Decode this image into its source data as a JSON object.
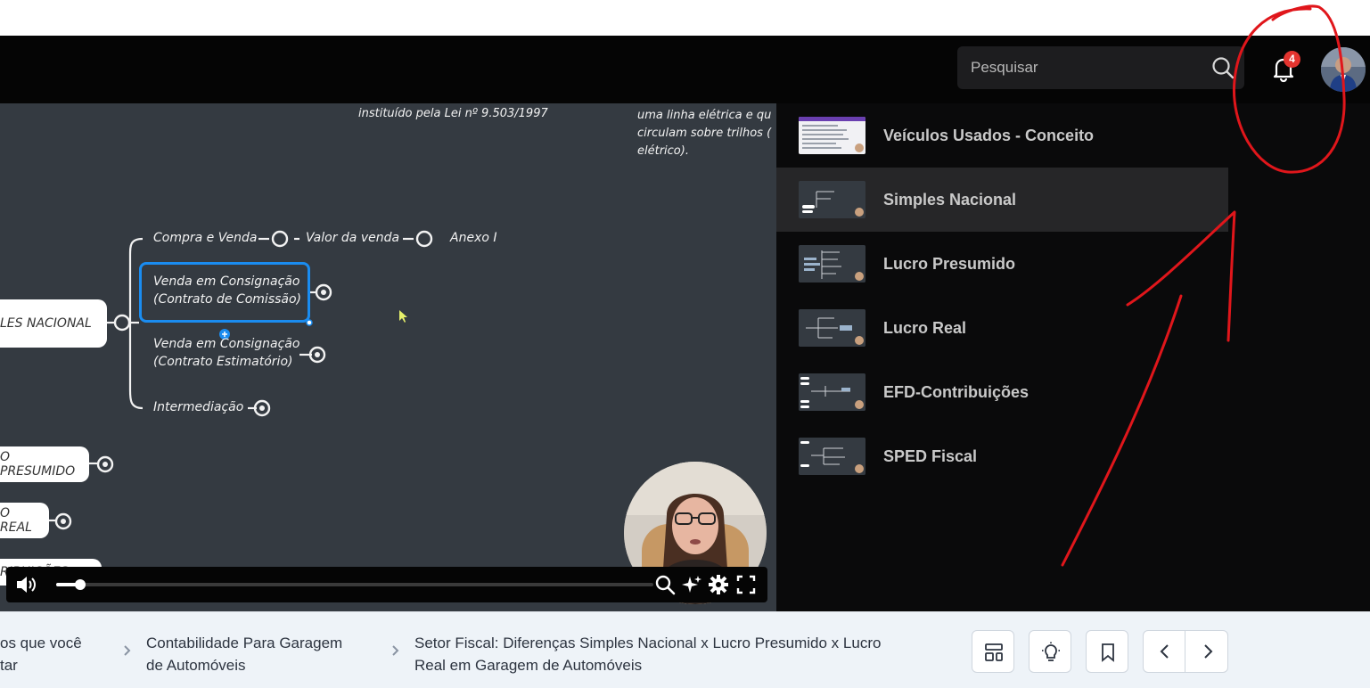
{
  "header": {
    "search_placeholder": "Pesquisar",
    "notification_count": "4"
  },
  "video": {
    "mindmap": {
      "top_left_note": "instituído pela Lei nº 9.503/1997",
      "top_right_note_lines": [
        "uma linha elétrica e qu",
        "circulam sobre trilhos (",
        "elétrico)."
      ],
      "branch_compra_venda": "Compra e Venda",
      "branch_valor_venda": "Valor da venda",
      "branch_anexo": "Anexo I",
      "branch_consignacao_comissao_1": "Venda em Consignação",
      "branch_consignacao_comissao_2": "(Contrato de Comissão)",
      "branch_consignacao_estimatorio_1": "Venda em Consignação",
      "branch_consignacao_estimatorio_2": "(Contrato Estimatório)",
      "branch_intermediacao": "Intermediação",
      "node_simples": "LES NACIONAL",
      "node_presumido": "O PRESUMIDO",
      "node_real": "O REAL",
      "node_partial": "RIBUIÇÕES"
    },
    "progress_percent": 4
  },
  "playlist": {
    "items": [
      {
        "title": "Veículos Usados - Conceito",
        "active": false
      },
      {
        "title": "Simples Nacional",
        "active": true
      },
      {
        "title": "Lucro Presumido",
        "active": false
      },
      {
        "title": "Lucro Real",
        "active": false
      },
      {
        "title": "EFD-Contribuições",
        "active": false
      },
      {
        "title": "SPED Fiscal",
        "active": false
      }
    ]
  },
  "breadcrumb": {
    "item1_line1": "os que você",
    "item1_line2": "tar",
    "item2_line1": "Contabilidade Para Garagem",
    "item2_line2": "de Automóveis",
    "item3_line1": "Setor Fiscal: Diferenças Simples Nacional x Lucro Presumido x Lucro",
    "item3_line2": "Real em Garagem de Automóveis"
  },
  "colors": {
    "accent_blue": "#1a8cf0",
    "badge_red": "#e3342f",
    "annotation_red": "#e0161b"
  }
}
